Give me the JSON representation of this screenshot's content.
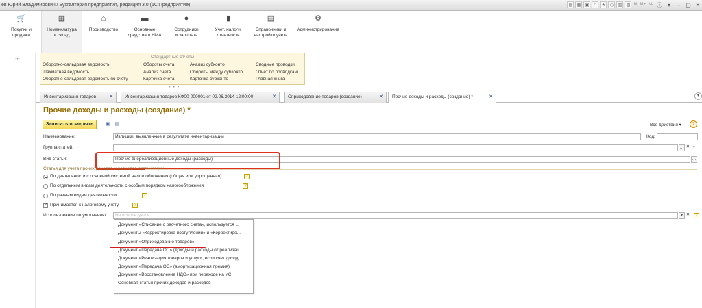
{
  "window": {
    "title": "ев Юрий Владимирович / Бухгалтерия предприятия, редакция 3.0 (1С:Предприятие)",
    "toolbar_marks": [
      "M",
      "M+",
      "M-"
    ]
  },
  "sections": [
    {
      "label": "Покупки и\nпродажи",
      "icon": "cart-icon"
    },
    {
      "label": "Номенклатура\nи склад",
      "icon": "grid-icon"
    },
    {
      "label": "Производство",
      "icon": "factory-icon"
    },
    {
      "label": "Основные\nсредства и НМА",
      "icon": "truck-icon"
    },
    {
      "label": "Сотрудники\nи зарплата",
      "icon": "people-icon"
    },
    {
      "label": "Учет, налоги,\nотчетность",
      "icon": "bar-chart-icon"
    },
    {
      "label": "Справочники и\nнастройки учета",
      "icon": "book-icon"
    },
    {
      "label": "Администрирование",
      "icon": "gear-icon"
    }
  ],
  "reports": {
    "title": "Стандартные отчеты",
    "col1": [
      "Оборотно-сальдовая ведомость",
      "Шахматная ведомость",
      "Оборотно-сальдовая ведомость по счету"
    ],
    "col2": [
      "Обороты счета",
      "Анализ счета",
      "Карточка счета"
    ],
    "col3": [
      "Анализ субконто",
      "Обороты между субконто",
      "Карточка субконто"
    ],
    "col4": [
      "Сводные проводки",
      "Отчет по проводкам",
      "Главная книга"
    ]
  },
  "tabs": [
    {
      "label": "Инвентаризация товаров"
    },
    {
      "label": "Инвентаризация товаров КФ00-000001 от 02.06.2014 12:00:00"
    },
    {
      "label": "Оприходование товаров (создание)"
    },
    {
      "label": "Прочие доходы и расходы (создание) *"
    }
  ],
  "form": {
    "title": "Прочие доходы и расходы (создание) *",
    "save_close_label": "Записать и закрыть",
    "all_actions_label": "Все действия ▾",
    "help_label": "?",
    "name_label": "Наименование:",
    "name_value": "Излишки, выявленные в результате инвентаризации",
    "code_label": "Код:",
    "code_value": "",
    "group_label": "Группа статей:",
    "group_value": "",
    "kind_label": "Вид статьи:",
    "kind_value": "Прочие внереализационные доходы (расходы)",
    "section_title": "Статья для учета прочих доходов и расходов организации",
    "radio_options": [
      "По деятельности с основной системой налогообложения (общая или упрощенная)",
      "По отдельным видам деятельности с особым порядком налогообложения",
      "По разным видам деятельности"
    ],
    "tax_label": "Принимается к налоговому учету",
    "usage_label": "Использование по умолчанию:",
    "usage_placeholder": "Не используется"
  },
  "dropdown_items": [
    "Документ «Списание с расчетного счета», используется ...",
    "Документы «Корректировка поступления» и «Корректиро...",
    "Документ «Оприходование товаров»",
    "Документ «Передача ОС» (доходы и расходы от реализац...",
    "Документ «Реализация товаров и услуг», если счет доход...",
    "Документ «Передача ОС» (амортизационная премия)",
    "Документ «Восстановление НДС» при переходе на УСН",
    "Основная статья прочих доходов и расходов"
  ]
}
